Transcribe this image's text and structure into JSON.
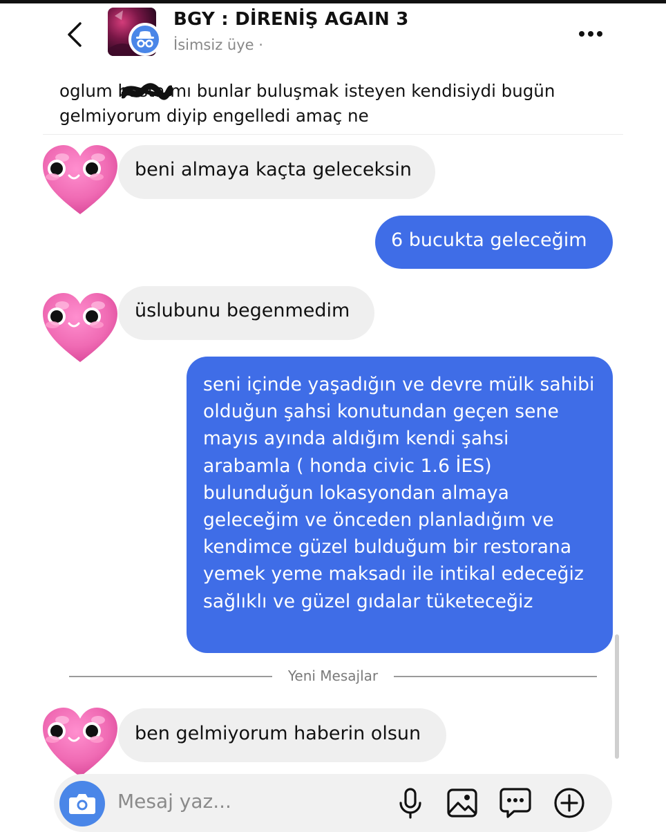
{
  "header": {
    "title": "BGY : DİRENİŞ AGAIN 3",
    "subtitle": "İsimsiz üye ·"
  },
  "pinned_text": "oglum basta mı bunlar buluşmak isteyen kendisiydi bugün gelmiyorum diyip engelledi amaç ne",
  "messages": [
    {
      "side": "in",
      "text": "beni almaya kaçta geleceksin"
    },
    {
      "side": "out",
      "text": "6 bucukta geleceğim"
    },
    {
      "side": "in",
      "text": "üslubunu begenmedim"
    },
    {
      "side": "out",
      "text": "seni içinde yaşadığın ve devre mülk sahibi olduğun şahsi konutundan geçen sene mayıs ayında aldığım kendi şahsi arabamla ( honda civic 1.6 İES) bulunduğun lokasyondan almaya geleceğim ve önceden planladığım ve kendimce güzel bulduğum bir restorana yemek yeme maksadı ile intikal edeceğiz sağlıklı ve güzel gıdalar tüketeceğiz"
    },
    {
      "side": "in",
      "text": "ben gelmiyorum haberin olsun"
    }
  ],
  "divider": {
    "label": "Yeni Mesajlar"
  },
  "composer": {
    "placeholder": "Mesaj yaz..."
  },
  "colors": {
    "outgoing_bubble": "#3f6de7",
    "incoming_bubble": "#efefef",
    "accent": "#4a86e8",
    "heart": "#f06bb4"
  },
  "icons": [
    "back-chevron-icon",
    "incognito-icon",
    "more-options-icon",
    "heart-avatar-icon",
    "camera-icon",
    "microphone-icon",
    "gallery-icon",
    "sticker-icon",
    "plus-icon"
  ]
}
